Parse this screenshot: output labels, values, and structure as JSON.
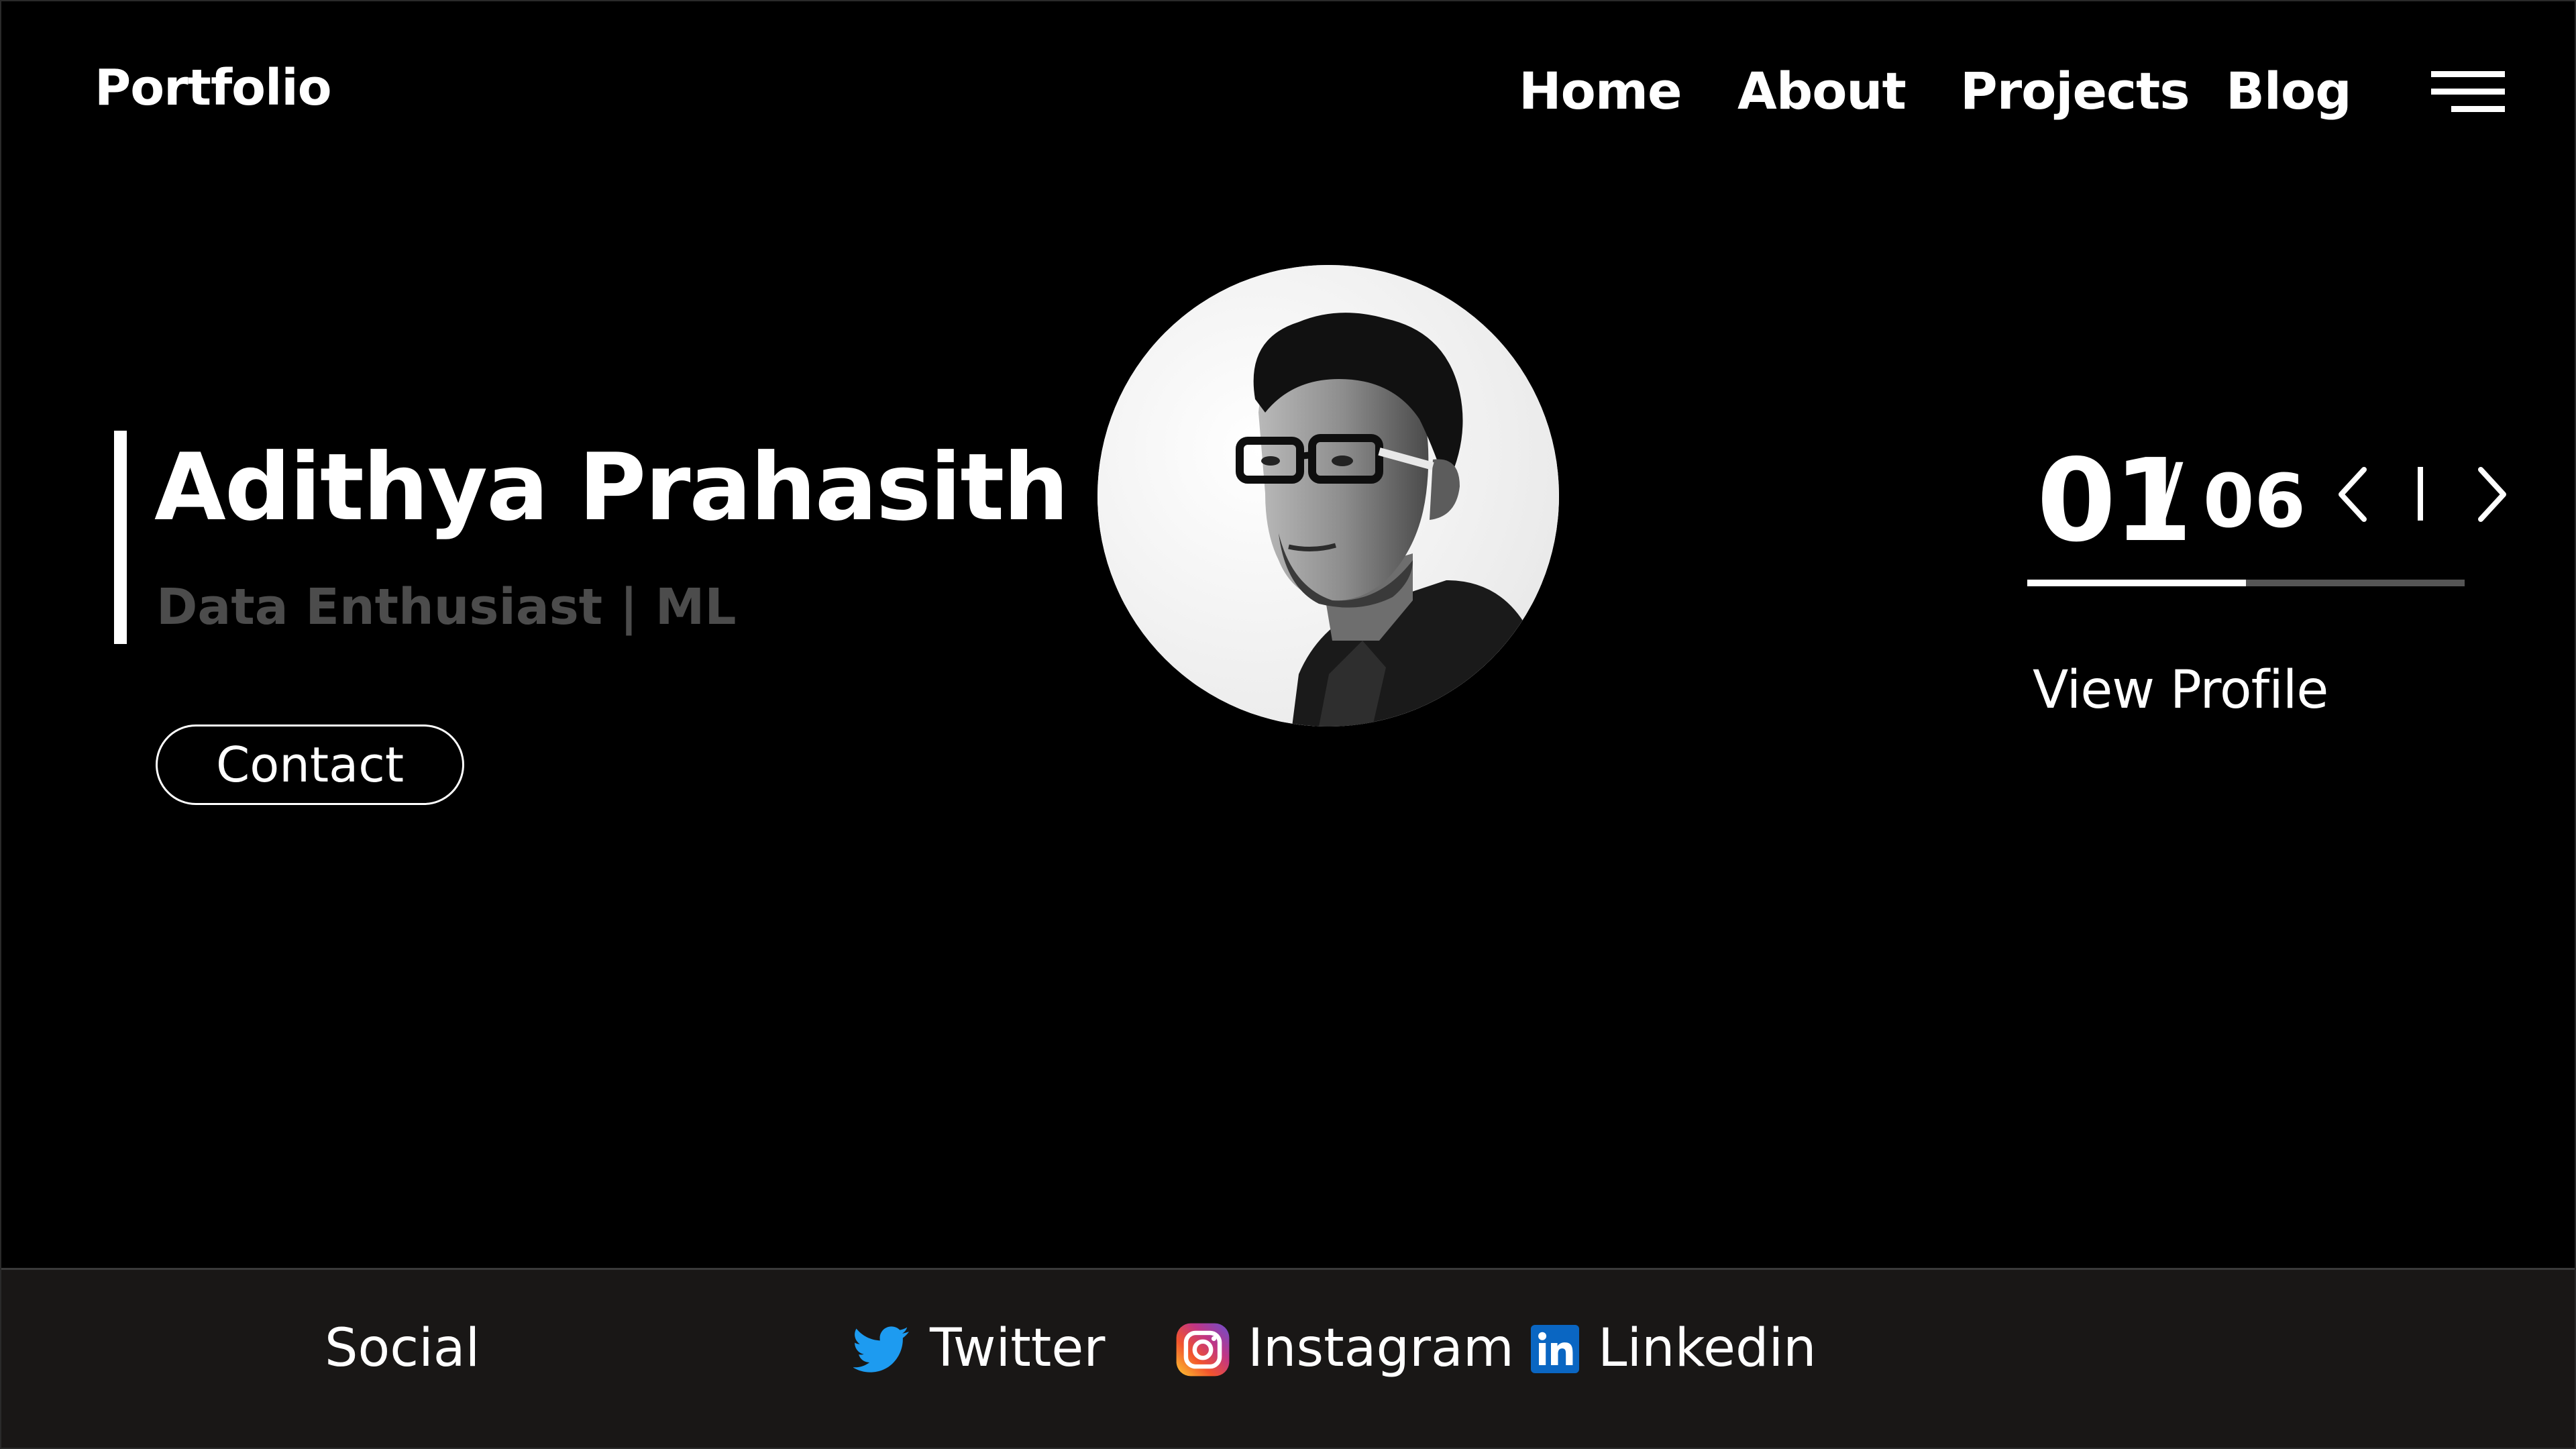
{
  "header": {
    "brand": "Portfolio",
    "nav": [
      {
        "label": "Home"
      },
      {
        "label": "About"
      },
      {
        "label": "Projects"
      },
      {
        "label": "Blog"
      }
    ],
    "menu_icon": "hamburger-menu-icon"
  },
  "hero": {
    "name": "Adithya Prahasith",
    "subtitle": "Data Enthusiast | ML",
    "contact_label": "Contact",
    "avatar_icon": "profile-photo"
  },
  "slider": {
    "current": "01",
    "separator": "/",
    "total": "06",
    "progress": 0.5,
    "prev_icon": "chevron-left-icon",
    "next_icon": "chevron-right-icon",
    "view_profile_label": "View Profile"
  },
  "footer": {
    "label": "Social",
    "links": [
      {
        "label": "Twitter",
        "icon": "twitter-icon"
      },
      {
        "label": "Instagram",
        "icon": "instagram-icon"
      },
      {
        "label": "Linkedin",
        "icon": "linkedin-icon"
      }
    ]
  },
  "colors": {
    "background": "#000000",
    "text": "#ffffff",
    "subtitle": "#4c4c4c",
    "footer_background": "#191716",
    "progress_track": "#555555",
    "twitter": "#1d9bf0",
    "linkedin": "#0a66c2"
  }
}
